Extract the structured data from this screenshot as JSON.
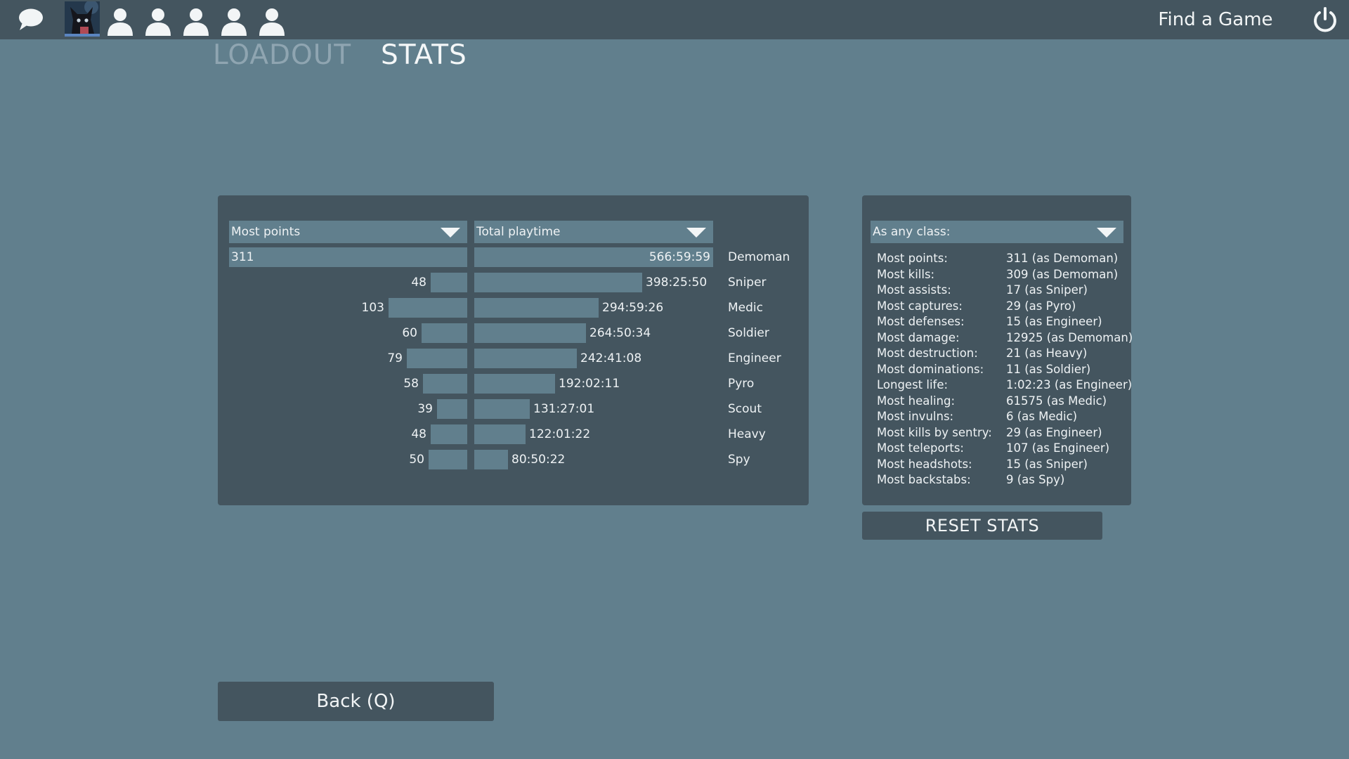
{
  "topbar": {
    "chat_icon": "chat-bubble-icon",
    "avatar_icon": "player-avatar",
    "party_slot_icon": "person-silhouette-icon",
    "party_slot_count": 5,
    "find_game_label": "Find a Game",
    "power_icon": "power-icon"
  },
  "tabs": [
    {
      "label": "LOADOUT",
      "active": false
    },
    {
      "label": "STATS",
      "active": true
    }
  ],
  "class_stats": {
    "sort_points_label": "Most points",
    "sort_time_label": "Total playtime",
    "rows": [
      {
        "class": "Demoman",
        "points": "311",
        "playtime": "566:59:59"
      },
      {
        "class": "Sniper",
        "points": "48",
        "playtime": "398:25:50"
      },
      {
        "class": "Medic",
        "points": "103",
        "playtime": "294:59:26"
      },
      {
        "class": "Soldier",
        "points": "60",
        "playtime": "264:50:34"
      },
      {
        "class": "Engineer",
        "points": "79",
        "playtime": "242:41:08"
      },
      {
        "class": "Pyro",
        "points": "58",
        "playtime": "192:02:11"
      },
      {
        "class": "Scout",
        "points": "39",
        "playtime": "131:27:01"
      },
      {
        "class": "Heavy",
        "points": "48",
        "playtime": "122:01:22"
      },
      {
        "class": "Spy",
        "points": "50",
        "playtime": "80:50:22"
      }
    ]
  },
  "records": {
    "filter_label": "As any class:",
    "items": [
      {
        "label": "Most points:",
        "value": "311 (as Demoman)"
      },
      {
        "label": "Most kills:",
        "value": "309 (as Demoman)"
      },
      {
        "label": "Most assists:",
        "value": "17 (as Sniper)"
      },
      {
        "label": "Most captures:",
        "value": "29 (as Pyro)"
      },
      {
        "label": "Most defenses:",
        "value": "15 (as Engineer)"
      },
      {
        "label": "Most damage:",
        "value": "12925 (as Demoman)"
      },
      {
        "label": "Most destruction:",
        "value": "21 (as Heavy)"
      },
      {
        "label": "Most dominations:",
        "value": "11 (as Soldier)"
      },
      {
        "label": "Longest life:",
        "value": "1:02:23 (as Engineer)"
      },
      {
        "label": "Most healing:",
        "value": "61575 (as Medic)"
      },
      {
        "label": "Most invulns:",
        "value": "6 (as Medic)"
      },
      {
        "label": "Most kills by sentry:",
        "value": "29 (as Engineer)"
      },
      {
        "label": "Most teleports:",
        "value": "107 (as Engineer)"
      },
      {
        "label": "Most headshots:",
        "value": "15 (as Sniper)"
      },
      {
        "label": "Most backstabs:",
        "value": "9 (as Spy)"
      }
    ]
  },
  "buttons": {
    "reset_label": "RESET STATS",
    "back_label": "Back (Q)"
  }
}
